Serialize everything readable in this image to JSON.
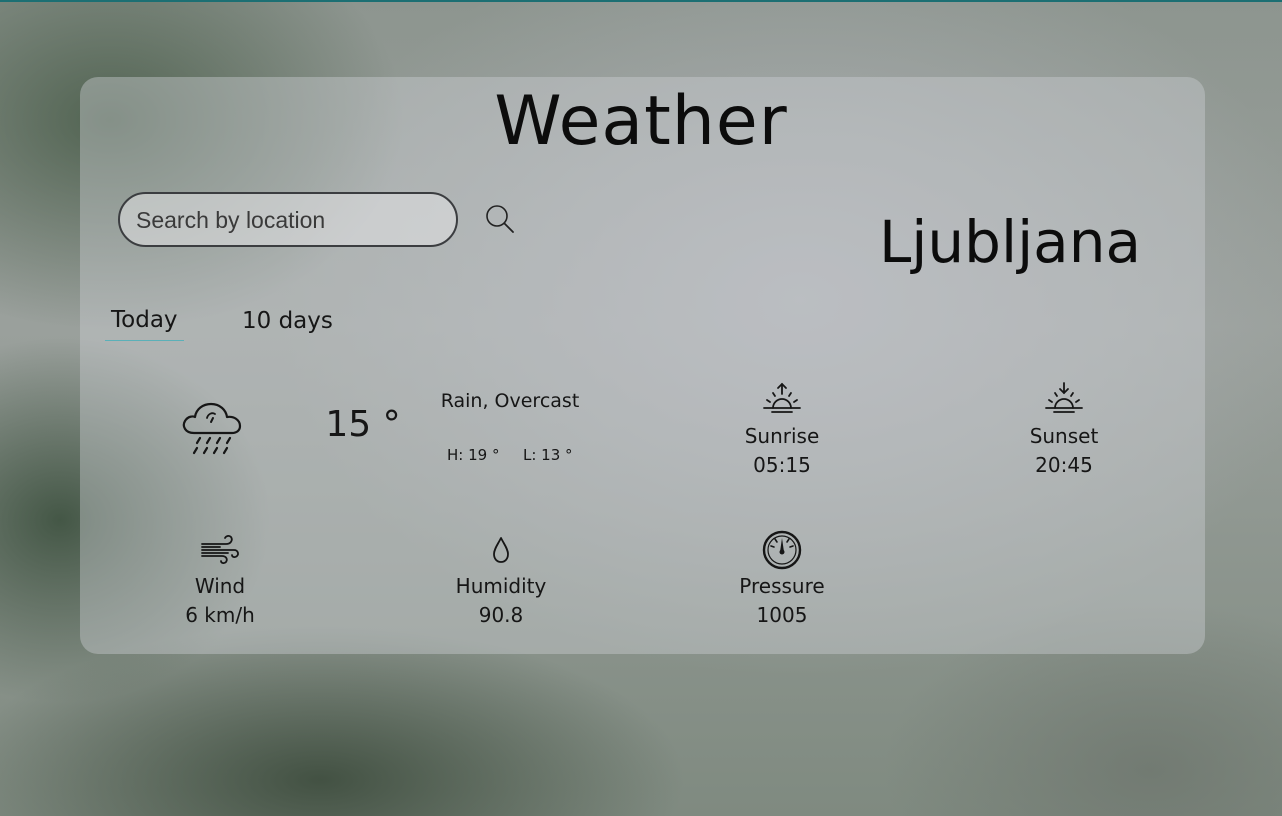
{
  "app": {
    "title": "Weather",
    "city": "Ljubljana"
  },
  "search": {
    "placeholder": "Search by location",
    "value": "",
    "button_icon": "search-icon"
  },
  "tabs": [
    {
      "label": "Today",
      "active": true
    },
    {
      "label": "10 days",
      "active": false
    }
  ],
  "current": {
    "icon": "rain-cloud-icon",
    "temperature": "15 °",
    "condition": "Rain, Overcast",
    "high": "H: 19 °",
    "low": "L: 13 °"
  },
  "stats": {
    "sunrise": {
      "label": "Sunrise",
      "value": "05:15",
      "icon": "sunrise-icon"
    },
    "sunset": {
      "label": "Sunset",
      "value": "20:45",
      "icon": "sunset-icon"
    },
    "wind": {
      "label": "Wind",
      "value": "6 km/h",
      "icon": "wind-icon"
    },
    "humidity": {
      "label": "Humidity",
      "value": "90.8",
      "icon": "droplet-icon"
    },
    "pressure": {
      "label": "Pressure",
      "value": "1005",
      "icon": "gauge-icon"
    }
  },
  "colors": {
    "tab_underline": "#5bb0b8",
    "top_bar": "#1c6f73"
  }
}
